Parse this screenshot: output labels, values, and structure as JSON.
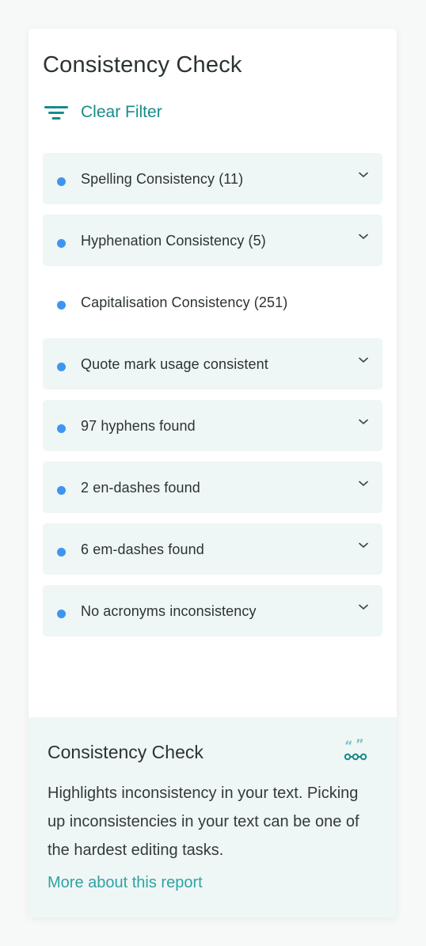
{
  "panel": {
    "title": "Consistency Check",
    "clear_filter_label": "Clear Filter",
    "filter_icon": "filter-icon"
  },
  "items": [
    {
      "label": "Spelling Consistency (11)",
      "expandable": true
    },
    {
      "label": "Hyphenation Consistency (5)",
      "expandable": true
    },
    {
      "label": "Capitalisation Consistency (251)",
      "expandable": false
    },
    {
      "label": "Quote mark usage consistent",
      "expandable": true
    },
    {
      "label": "97 hyphens found",
      "expandable": true
    },
    {
      "label": "2 en-dashes found",
      "expandable": true
    },
    {
      "label": "6 em-dashes found",
      "expandable": true
    },
    {
      "label": "No acronyms inconsistency",
      "expandable": true
    }
  ],
  "footer": {
    "title": "Consistency Check",
    "icon": "quote-consistency-icon",
    "description": "Highlights inconsistency in your text. Picking up inconsistencies in your text can be one of the hardest editing tasks.",
    "link_label": "More about this report"
  },
  "colors": {
    "accent": "#1a8a8a",
    "link": "#2fa3a3",
    "dot": "#3d95f1",
    "item_bg": "#eff6f6"
  }
}
